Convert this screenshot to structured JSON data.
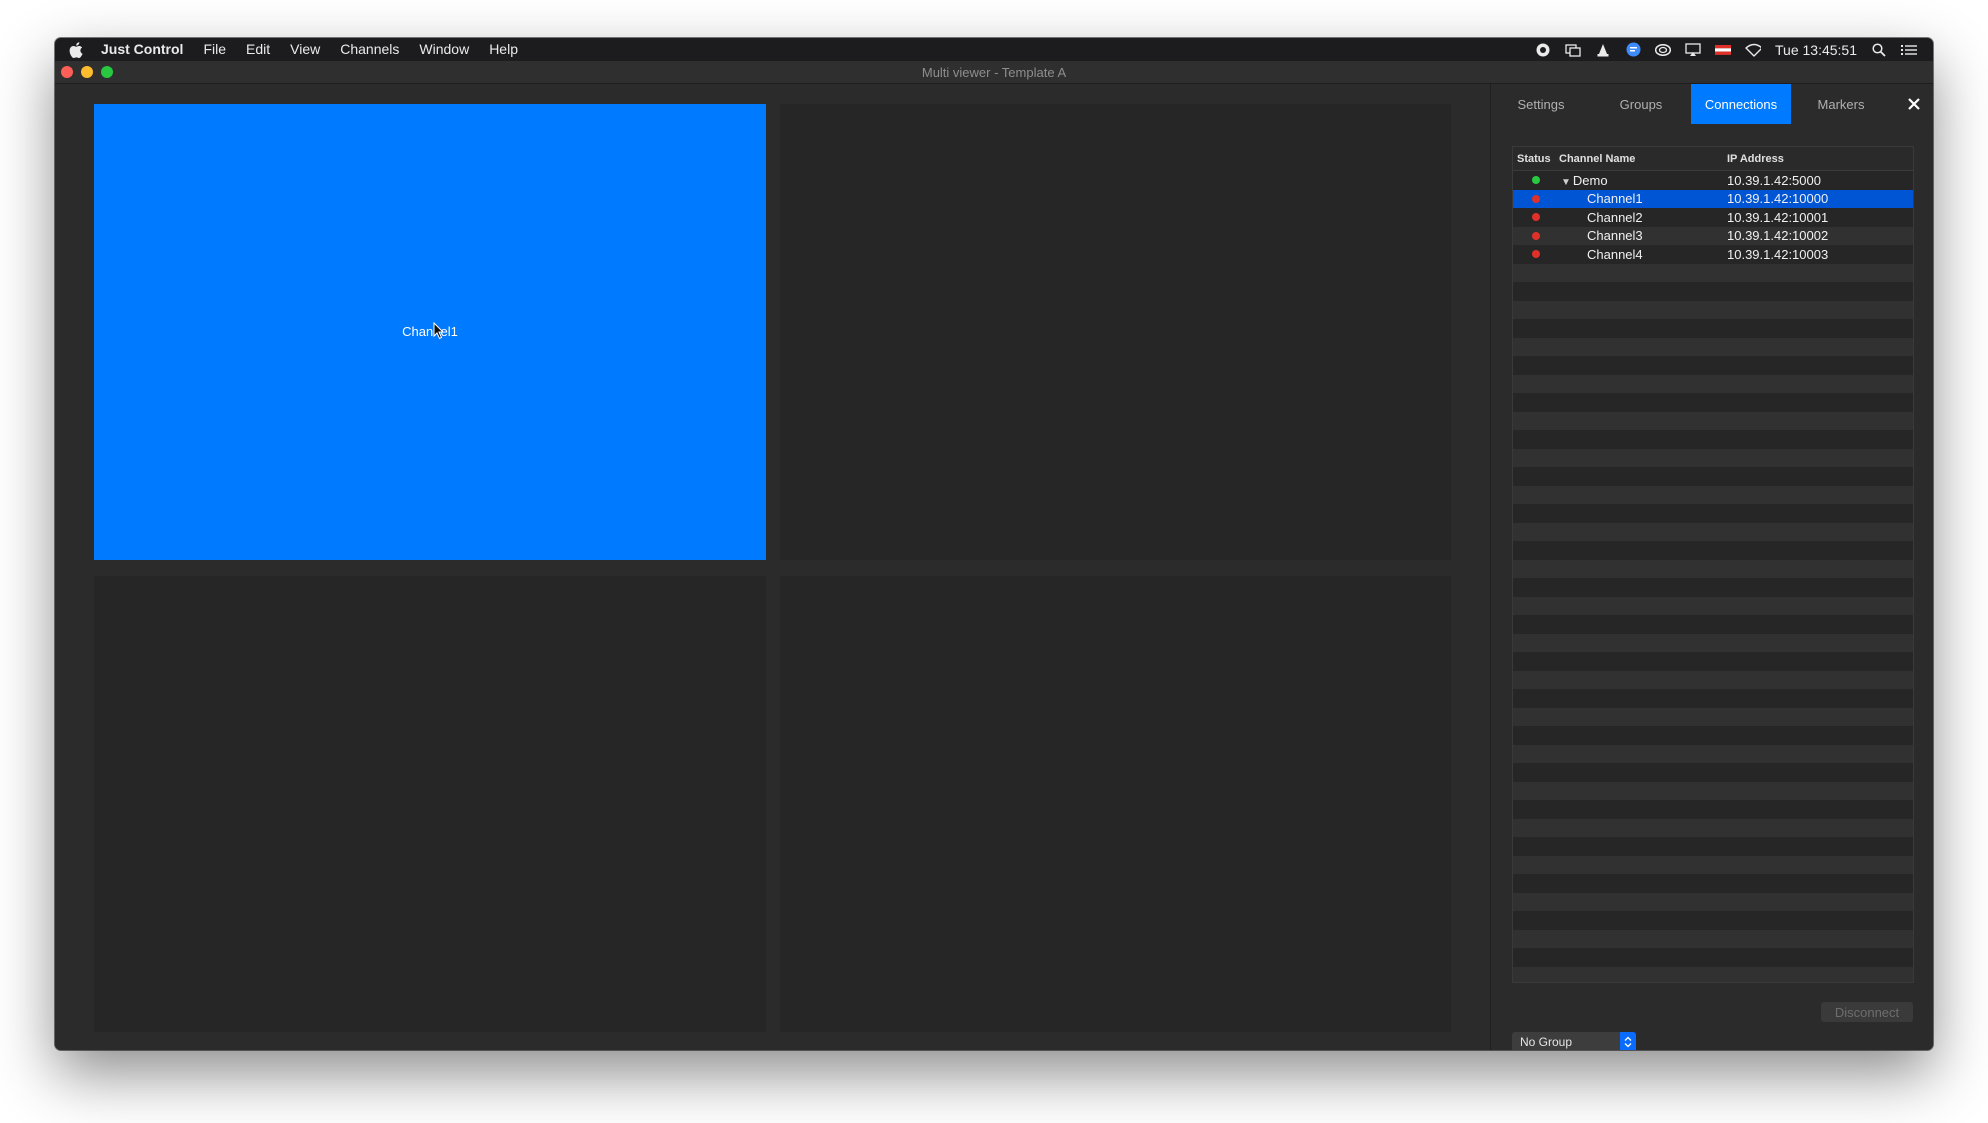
{
  "menubar": {
    "apple_icon": "apple-icon",
    "app_name": "Just Control",
    "menus": [
      "File",
      "Edit",
      "View",
      "Channels",
      "Window",
      "Help"
    ],
    "status_icons": [
      "record-icon",
      "windows-icon",
      "vlc-icon",
      "chat-icon",
      "creative-cloud-icon",
      "airplay-icon",
      "flag-icon",
      "wifi-icon"
    ],
    "clock": "Tue 13:45:51",
    "search_icon": "search-icon",
    "notification_icon": "list-icon"
  },
  "window": {
    "title": "Multi viewer - Template A"
  },
  "viewer": {
    "tiles": [
      {
        "label": "Channel1",
        "active": true
      },
      {
        "label": "",
        "active": false
      },
      {
        "label": "",
        "active": false
      },
      {
        "label": "",
        "active": false
      }
    ]
  },
  "panel": {
    "tabs": [
      "Settings",
      "Groups",
      "Connections",
      "Markers"
    ],
    "active_tab": "Connections",
    "close_icon": "close-icon",
    "table": {
      "columns": [
        "Status",
        "Channel Name",
        "IP Address"
      ],
      "rows": [
        {
          "status": "green",
          "name": "Demo",
          "ip": "10.39.1.42:5000",
          "expanded": true
        },
        {
          "status": "red",
          "name": "Channel1",
          "ip": "10.39.1.42:10000",
          "selected": true
        },
        {
          "status": "red",
          "name": "Channel2",
          "ip": "10.39.1.42:10001"
        },
        {
          "status": "red",
          "name": "Channel3",
          "ip": "10.39.1.42:10002"
        },
        {
          "status": "red",
          "name": "Channel4",
          "ip": "10.39.1.42:10003"
        }
      ]
    },
    "disconnect_label": "Disconnect",
    "group_select_value": "No Group"
  },
  "colors": {
    "accent": "#007aff",
    "selection": "#0055d4",
    "status_green": "#28c840",
    "status_red": "#e0302a"
  }
}
